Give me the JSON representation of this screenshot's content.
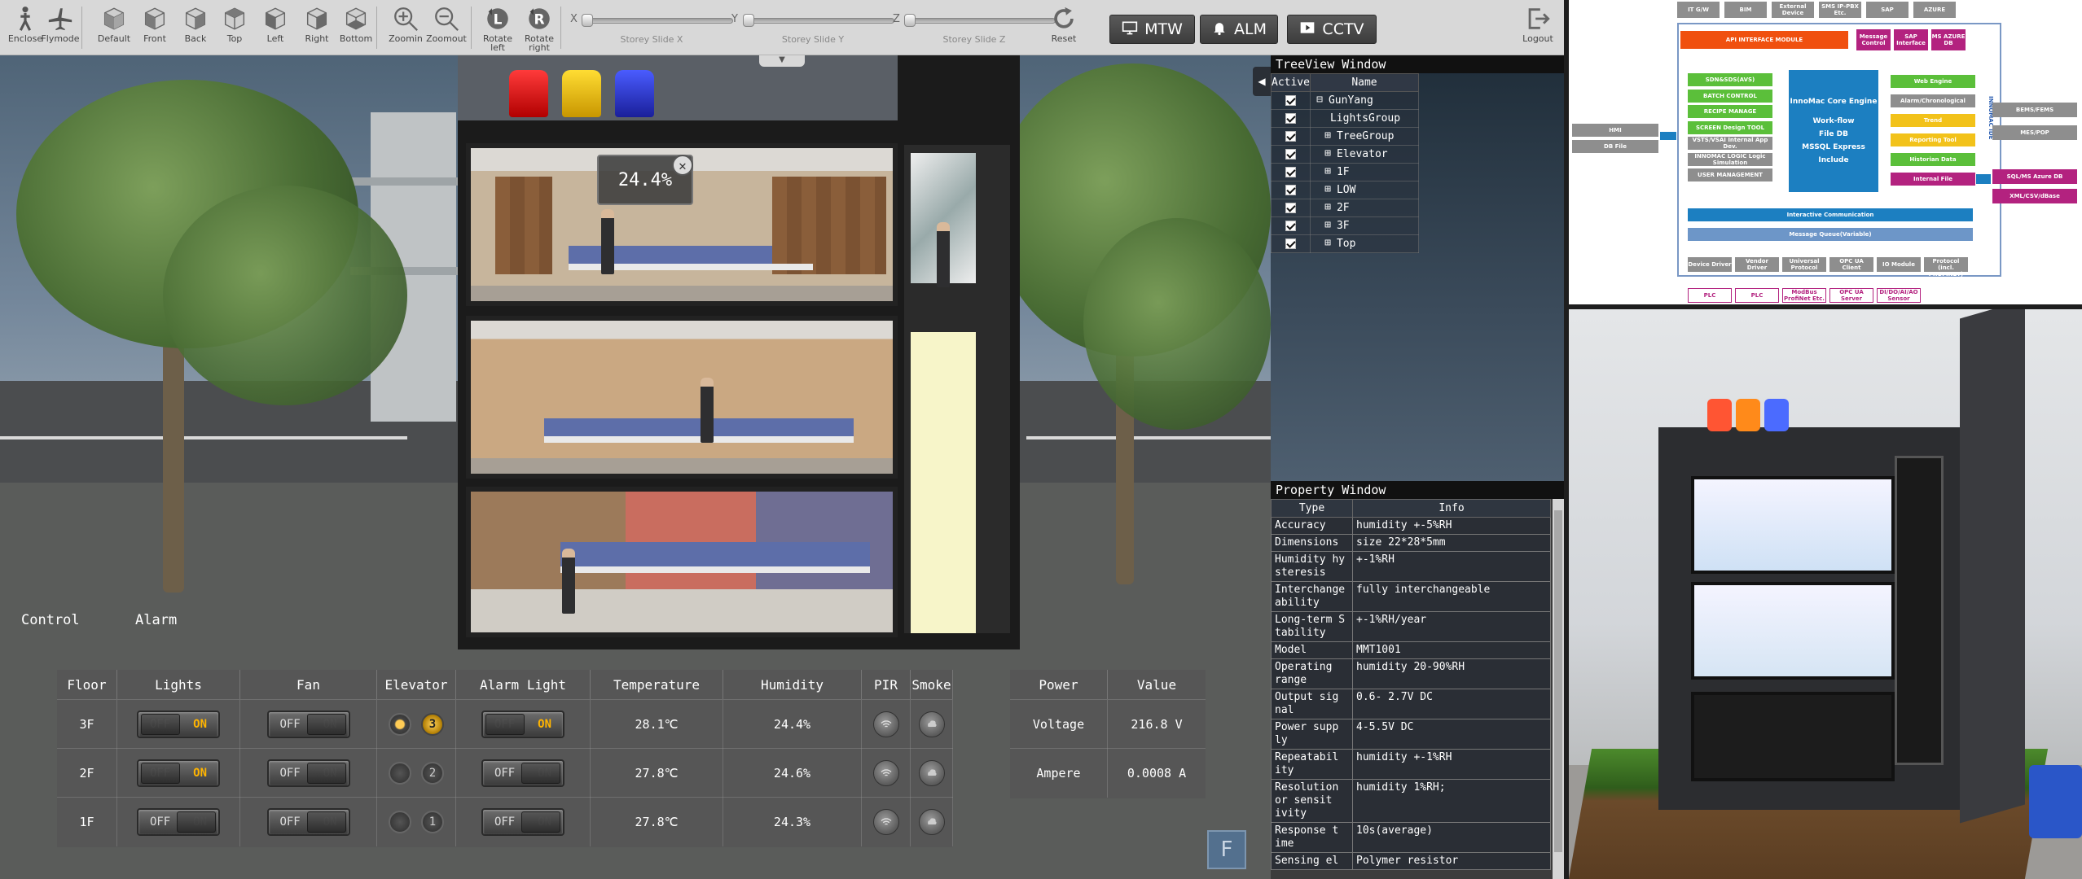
{
  "toolbar": {
    "view_buttons": [
      {
        "label": "Enclose",
        "icon": "walker-icon"
      },
      {
        "label": "Flymode",
        "icon": "airplane-icon"
      },
      {
        "label": "Default",
        "icon": "cube-default-icon"
      },
      {
        "label": "Front",
        "icon": "cube-front-icon"
      },
      {
        "label": "Back",
        "icon": "cube-back-icon"
      },
      {
        "label": "Top",
        "icon": "cube-top-icon"
      },
      {
        "label": "Left",
        "icon": "cube-left-icon"
      },
      {
        "label": "Right",
        "icon": "cube-right-icon"
      },
      {
        "label": "Bottom",
        "icon": "cube-bottom-icon"
      },
      {
        "label": "Zoomin",
        "icon": "zoom-in-icon"
      },
      {
        "label": "Zoomout",
        "icon": "zoom-out-icon"
      },
      {
        "label": "Rotate left",
        "icon": "rotate-left-icon",
        "glyph": "L"
      },
      {
        "label": "Rotate right",
        "icon": "rotate-right-icon",
        "glyph": "R"
      }
    ],
    "sliders": [
      {
        "axis": "X",
        "label": "Storey Slide X"
      },
      {
        "axis": "Y",
        "label": "Storey Slide Y"
      },
      {
        "axis": "Z",
        "label": "Storey Slide Z"
      }
    ],
    "reset_label": "Reset",
    "mtw_label": "MTW",
    "alm_label": "ALM",
    "cctv_label": "CCTV",
    "logout_label": "Logout"
  },
  "tree_window": {
    "title": "TreeView Window",
    "col_active": "Active",
    "col_name": "Name",
    "items": [
      {
        "name": "GunYang",
        "expander": "⊟",
        "indent": 0
      },
      {
        "name": "LightsGroup",
        "expander": "",
        "indent": 2
      },
      {
        "name": "TreeGroup",
        "expander": "⊞",
        "indent": 1
      },
      {
        "name": "Elevator",
        "expander": "⊞",
        "indent": 1
      },
      {
        "name": "1F",
        "expander": "⊞",
        "indent": 1
      },
      {
        "name": "LOW",
        "expander": "⊞",
        "indent": 1
      },
      {
        "name": "2F",
        "expander": "⊞",
        "indent": 1
      },
      {
        "name": "3F",
        "expander": "⊞",
        "indent": 1
      },
      {
        "name": "Top",
        "expander": "⊞",
        "indent": 1
      }
    ]
  },
  "property_window": {
    "title": "Property Window",
    "col_type": "Type",
    "col_info": "Info",
    "rows": [
      {
        "type": "Accuracy",
        "info": "humidity +-5%RH"
      },
      {
        "type": "Dimensions",
        "info": "size 22*28*5mm"
      },
      {
        "type": "Humidity hy steresis",
        "info": "+-1%RH"
      },
      {
        "type": "Interchange ability",
        "info": "fully interchangeable"
      },
      {
        "type": "Long-term S tability",
        "info": "+-1%RH/year"
      },
      {
        "type": "Model",
        "info": "MMT1001"
      },
      {
        "type": "Operating range",
        "info": "humidity 20-90%RH"
      },
      {
        "type": "Output sig nal",
        "info": "0.6- 2.7V DC"
      },
      {
        "type": "Power supp ly",
        "info": "4-5.5V DC"
      },
      {
        "type": "Repeatabil ity",
        "info": "humidity +-1%RH"
      },
      {
        "type": "Resolution or sensit ivity",
        "info": "humidity 1%RH;"
      },
      {
        "type": "Response t ime",
        "info": "10s(average)"
      },
      {
        "type": "Sensing el",
        "info": "Polymer resistor"
      }
    ]
  },
  "tooltip": {
    "value": "24.4%"
  },
  "tabs": {
    "control": "Control",
    "alarm": "Alarm"
  },
  "control_panel": {
    "headers": [
      "Floor",
      "Lights",
      "Fan",
      "Elevator",
      "Alarm Light",
      "Temperature",
      "Humidity",
      "PIR",
      "Smoke"
    ],
    "on_label": "ON",
    "off_label": "OFF",
    "rows": [
      {
        "floor": "3F",
        "lights": "on",
        "fan": "off",
        "elevator_num": "3",
        "elevator_lit": true,
        "lamp_on": true,
        "alarm_light": "on",
        "temperature": "28.1℃",
        "humidity": "24.4%"
      },
      {
        "floor": "2F",
        "lights": "on",
        "fan": "off",
        "elevator_num": "2",
        "elevator_lit": false,
        "lamp_on": false,
        "alarm_light": "off",
        "temperature": "27.8℃",
        "humidity": "24.6%"
      },
      {
        "floor": "1F",
        "lights": "off",
        "fan": "off",
        "elevator_num": "1",
        "elevator_lit": false,
        "lamp_on": false,
        "alarm_light": "off",
        "temperature": "27.8℃",
        "humidity": "24.3%"
      }
    ]
  },
  "power_panel": {
    "header_power": "Power",
    "header_value": "Value",
    "rows": [
      {
        "name": "Voltage",
        "value": "216.8 V"
      },
      {
        "name": "Ampere",
        "value": "0.0008 A"
      }
    ]
  },
  "f_button": "F",
  "architecture": {
    "top_boxes": [
      "IT G/W",
      "BIM",
      "External Device",
      "SMS IP-PBX Etc.",
      "SAP",
      "AZURE"
    ],
    "api_label": "API INTERFACE MODULE",
    "api_side": [
      "Message Control",
      "SAP Interface",
      "MS AZURE DB"
    ],
    "side_vertical": "INNOMAC IDE",
    "left_modules": [
      "SDN&SDS(AVS)",
      "BATCH CONTROL",
      "RECIPE MANAGE",
      "SCREEN Design TOOL",
      "VSTS/VSAI Internal App Dev.",
      "INNOMAC LOGIC Logic Simulation",
      "USER MANAGEMENT"
    ],
    "core_title": "InnoMac Core Engine",
    "core_items": [
      "Work-flow",
      "File DB",
      "MSSQL Express",
      "Include"
    ],
    "right_modules": [
      "Web Engine",
      "Alarm/Chronological",
      "Trend",
      "Reporting Tool",
      "Historian Data",
      "Internal File"
    ],
    "far_left": [
      "HMI",
      "DB File"
    ],
    "far_right_top": [
      "BEMS/FEMS",
      "MES/POP"
    ],
    "far_right_bottom": [
      "SQL/MS Azure DB",
      "XML/CSV/dBase"
    ],
    "interactive_label": "Interactive Communication",
    "queue_label": "Message Queue(Variable)",
    "drivers": [
      "Device Driver",
      "Vendor Driver",
      "Universal Protocol",
      "OPC UA Client",
      "IO Module",
      "Industrial Protocol (incl. PROFINET)"
    ],
    "devices": [
      "PLC",
      "PLC",
      "ModBus ProfiNet Etc.",
      "OPC UA Server",
      "DI/DO/AI/AO Sensor"
    ]
  },
  "colors": {
    "toolbar_bg": "#d8d8d8",
    "api_orange": "#f0500f",
    "core_blue": "#1c7fc1",
    "module_green": "#5bbf3a",
    "module_yellow": "#f2c21a",
    "module_purple": "#b3227f",
    "alarm_on": "#ffb400"
  }
}
